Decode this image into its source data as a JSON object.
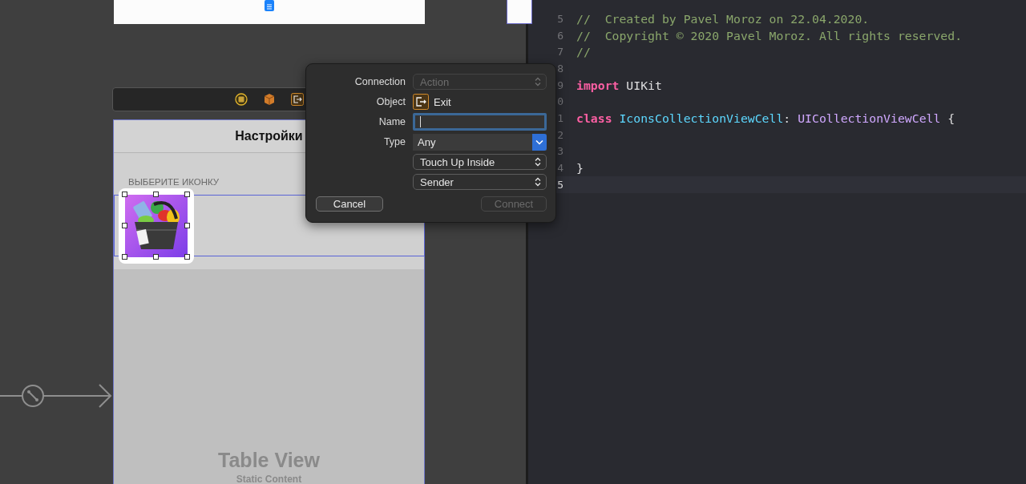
{
  "storyboard": {
    "nav_title": "Настройки",
    "section_header": "ВЫБЕРИТЕ ИКОНКУ",
    "icon_cell": {
      "selected": true
    },
    "placeholder_title": "Table View",
    "placeholder_subtitle": "Static Content"
  },
  "connection_popover": {
    "rows": [
      {
        "label": "Connection",
        "kind": "popup",
        "value": "Action",
        "disabled": true
      },
      {
        "label": "Object",
        "kind": "object",
        "value": "Exit"
      },
      {
        "label": "Name",
        "kind": "text",
        "focused": true
      },
      {
        "label": "Type",
        "kind": "combo",
        "value": "Any"
      },
      {
        "kind": "popup",
        "value": "Touch Up Inside",
        "disabled": false
      },
      {
        "kind": "popup",
        "value": "Sender",
        "disabled": false
      }
    ],
    "buttons": [
      {
        "label": "Cancel",
        "disabled": false
      },
      {
        "label": "Connect",
        "disabled": true
      }
    ]
  },
  "editor": {
    "lines": [
      {
        "number": "5",
        "current": false,
        "tokens": [
          {
            "kind": "comment",
            "text": "//  Created by Pavel Moroz on 22.04.2020."
          }
        ]
      },
      {
        "number": "6",
        "current": false,
        "tokens": [
          {
            "kind": "comment",
            "text": "//  Copyright © 2020 Pavel Moroz. All rights reserved."
          }
        ]
      },
      {
        "number": "7",
        "current": false,
        "tokens": [
          {
            "kind": "comment",
            "text": "//"
          }
        ]
      },
      {
        "number": "8",
        "current": false
      },
      {
        "number": "9",
        "current": false,
        "tokens": [
          {
            "kind": "keyword",
            "text": "import"
          },
          {
            "kind": "plain",
            "text": " UIKit"
          }
        ]
      },
      {
        "number": "0",
        "current": false
      },
      {
        "number": "1",
        "current": false,
        "tokens": [
          {
            "kind": "keyword",
            "text": "class"
          },
          {
            "kind": "declaration",
            "text": " IconsCollectionViewCell"
          },
          {
            "kind": "plain",
            "text": ": "
          },
          {
            "kind": "type",
            "text": "UICollectionViewCell"
          },
          {
            "kind": "plain",
            "text": " {"
          }
        ]
      },
      {
        "number": "2",
        "current": false
      },
      {
        "number": "3",
        "current": false
      },
      {
        "number": "4",
        "current": false,
        "tokens": [
          {
            "kind": "plain",
            "text": "}"
          }
        ]
      },
      {
        "number": "5",
        "current": true
      }
    ]
  }
}
